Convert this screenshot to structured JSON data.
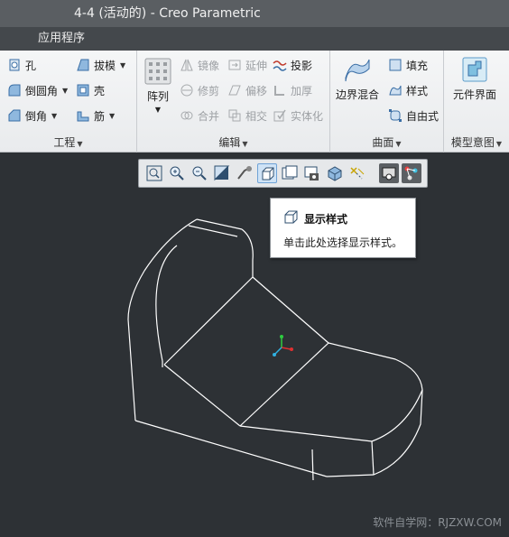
{
  "window": {
    "title": "4-4 (活动的) - Creo Parametric"
  },
  "menubar": {
    "item": "应用程序"
  },
  "ribbon": {
    "engineering": {
      "label": "工程",
      "hole": "孔",
      "draft": "拔模",
      "round": "倒圆角",
      "shell": "壳",
      "chamfer": "倒角",
      "rib": "筋"
    },
    "editing": {
      "label": "编辑",
      "pattern": "阵列",
      "mirror": "镜像",
      "extend": "延伸",
      "project": "投影",
      "trim": "修剪",
      "offset": "偏移",
      "thicken": "加厚",
      "merge": "合并",
      "intersect": "相交",
      "solidify": "实体化"
    },
    "surfaces": {
      "label": "曲面",
      "boundary_blend": "边界混合",
      "fill": "填充",
      "style": "样式",
      "freestyle": "自由式"
    },
    "model_intent": {
      "label": "模型意图",
      "component_interface": "元件界面"
    }
  },
  "view_toolbar": {
    "buttons": [
      "zoom-fit-icon",
      "zoom-in-icon",
      "zoom-out-icon",
      "repaint-icon",
      "orient-icon",
      "display-style-icon",
      "saved-views-icon",
      "section-icon",
      "perspective-icon",
      "datum-display-icon",
      "spin-center-icon",
      "annotation-icon"
    ],
    "active": "display-style-icon"
  },
  "tooltip": {
    "title": "显示样式",
    "description": "单击此处选择显示样式。"
  },
  "viewport": {
    "background": "#2d3135"
  },
  "watermark": "软件自学网：RJZXW.COM"
}
